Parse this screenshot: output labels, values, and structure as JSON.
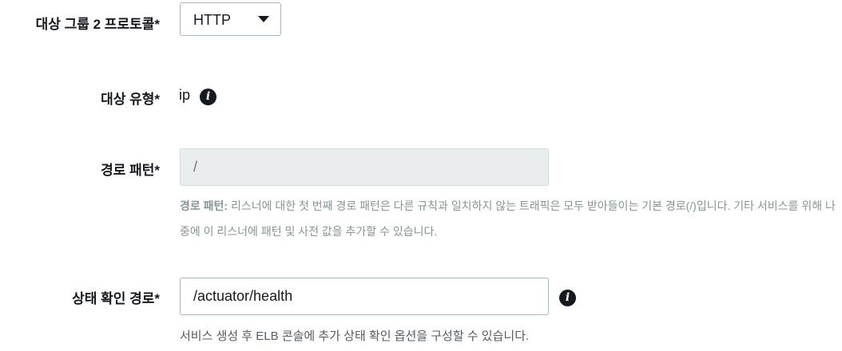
{
  "fields": {
    "protocol": {
      "label": "대상 그룹 2 프로토콜*",
      "value": "HTTP"
    },
    "target_type": {
      "label": "대상 유형*",
      "value": "ip"
    },
    "path_pattern": {
      "label": "경로 패턴*",
      "value": "/",
      "help_title": "경로 패턴:",
      "help_text": " 리스너에 대한 첫 번째 경로 패턴은 다른 규칙과 일치하지 않는 트래픽은 모두 받아들이는 기본 경로(/)입니다. 기타 서비스를 위해 나중에 이 리스너에 패턴 및 사전 값을 추가할 수 있습니다."
    },
    "health_check": {
      "label": "상태 확인 경로*",
      "value": "/actuator/health",
      "help_text": "서비스 생성 후 ELB 콘솔에 추가 상태 확인 옵션을 구성할 수 있습니다."
    }
  },
  "icons": {
    "info": "info-icon",
    "dropdown": "caret-down-icon"
  },
  "colors": {
    "text": "#16191f",
    "muted": "#879596",
    "input_border": "#aab7b8",
    "disabled_bg": "#eaeded"
  }
}
